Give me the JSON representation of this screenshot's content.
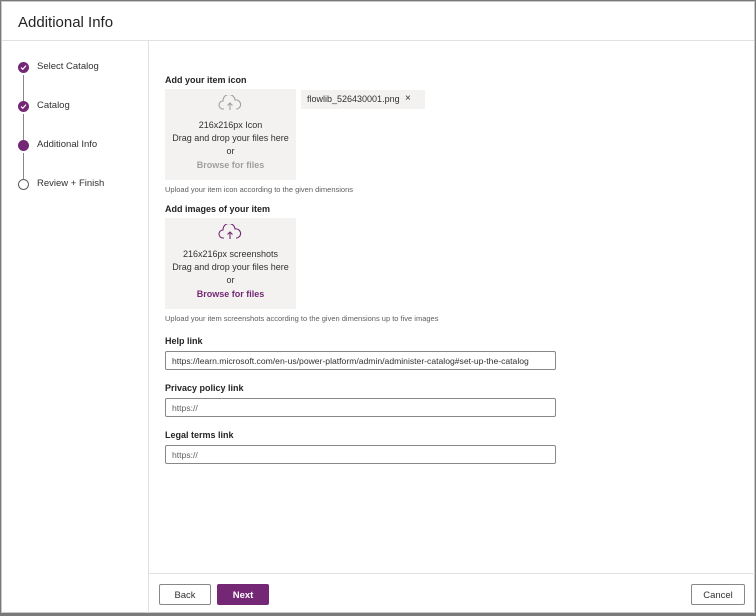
{
  "dialog": {
    "title": "Additional Info"
  },
  "steps": [
    {
      "label": "Select Catalog",
      "state": "done"
    },
    {
      "label": "Catalog",
      "state": "done"
    },
    {
      "label": "Additional Info",
      "state": "current"
    },
    {
      "label": "Review + Finish",
      "state": "todo"
    }
  ],
  "icon_section": {
    "label": "Add your item icon",
    "dims": "216x216px Icon",
    "drag_text": "Drag and drop your files here",
    "or_text": "or",
    "browse_label": "Browse for files",
    "hint": "Upload your item icon according to the given dimensions",
    "uploaded_file": "flowlib_526430001.png",
    "remove_glyph": "×"
  },
  "images_section": {
    "label": "Add images of your item",
    "dims": "216x216px screenshots",
    "drag_text": "Drag and drop your files here",
    "or_text": "or",
    "browse_label": "Browse for files",
    "hint": "Upload your item screenshots according to the given dimensions up to five images"
  },
  "help_link": {
    "label": "Help link",
    "value": "https://learn.microsoft.com/en-us/power-platform/admin/administer-catalog#set-up-the-catalog"
  },
  "privacy_link": {
    "label": "Privacy policy link",
    "placeholder": "https://"
  },
  "legal_link": {
    "label": "Legal terms link",
    "placeholder": "https://"
  },
  "footer": {
    "back_label": "Back",
    "next_label": "Next",
    "cancel_label": "Cancel"
  },
  "colors": {
    "accent": "#742774",
    "disabled_text": "#a19f9d",
    "surface": "#f3f2f1"
  },
  "icons": {
    "step_done": "checkmark-icon",
    "upload": "cloud-upload-icon",
    "remove": "close-icon"
  }
}
